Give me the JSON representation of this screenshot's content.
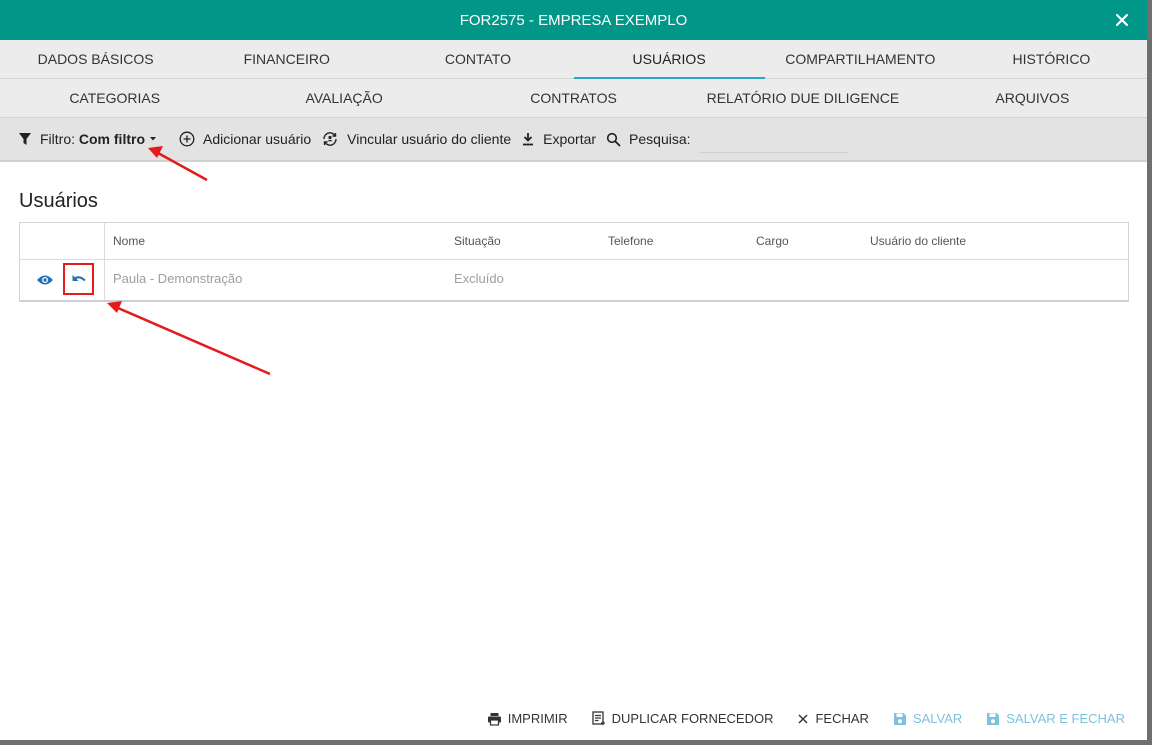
{
  "window": {
    "title": "FOR2575 - EMPRESA EXEMPLO"
  },
  "tabs_row1": [
    {
      "label": "DADOS BÁSICOS"
    },
    {
      "label": "FINANCEIRO"
    },
    {
      "label": "CONTATO"
    },
    {
      "label": "USUÁRIOS"
    },
    {
      "label": "COMPARTILHAMENTO"
    },
    {
      "label": "HISTÓRICO"
    }
  ],
  "tabs_row2": [
    {
      "label": "CATEGORIAS"
    },
    {
      "label": "AVALIAÇÃO"
    },
    {
      "label": "CONTRATOS"
    },
    {
      "label": "RELATÓRIO DUE DILIGENCE"
    },
    {
      "label": "ARQUIVOS"
    }
  ],
  "toolbar": {
    "filter_label": "Filtro:",
    "filter_value": "Com filtro",
    "add_user": "Adicionar usuário",
    "link_user": "Vincular usuário do cliente",
    "export": "Exportar",
    "search_label": "Pesquisa:",
    "search_value": ""
  },
  "section": {
    "title": "Usuários"
  },
  "table": {
    "headers": [
      "Nome",
      "Situação",
      "Telefone",
      "Cargo",
      "Usuário do cliente"
    ],
    "rows": [
      {
        "nome": "Paula - Demonstração",
        "situacao": "Excluído",
        "telefone": "",
        "cargo": "",
        "usuario_cliente": ""
      }
    ]
  },
  "footer": {
    "print": "IMPRIMIR",
    "duplicate": "DUPLICAR FORNECEDOR",
    "close": "FECHAR",
    "save": "SALVAR",
    "save_close": "SALVAR E FECHAR"
  },
  "colors": {
    "header": "#009688",
    "accent": "#2aa6c9",
    "icon_blue": "#1e73b8",
    "annotation": "#e31b1b"
  }
}
